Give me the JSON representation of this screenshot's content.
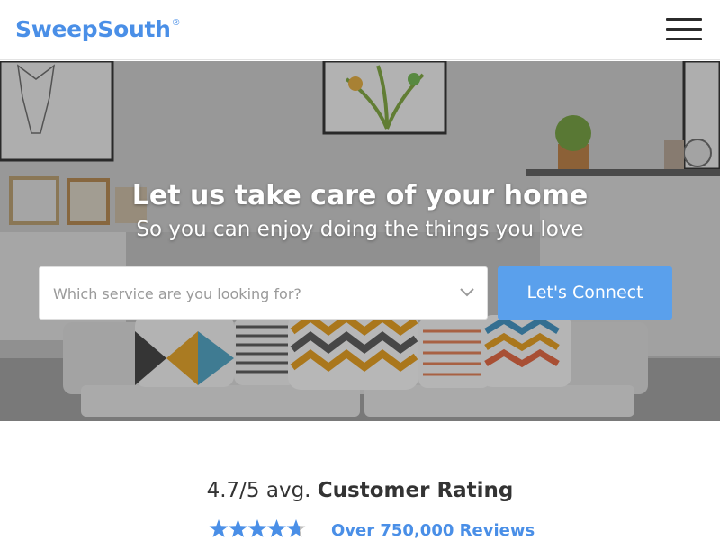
{
  "header": {
    "logo_text": "SweepSouth",
    "logo_mark": "®",
    "menu_icon": "hamburger-menu-icon"
  },
  "hero": {
    "title": "Let us take care of your home",
    "subtitle": "So you can enjoy doing the things you love",
    "service_select": {
      "placeholder": "Which service are you looking for?",
      "icon": "chevron-down-icon"
    },
    "connect_button": "Let's Connect"
  },
  "rating": {
    "score": "4.7/5 avg.",
    "label": "Customer Rating",
    "stars_value": 4.7,
    "stars_max": 5,
    "reviews_link": "Over 750,000 Reviews"
  },
  "colors": {
    "brand_blue": "#4a8fe7",
    "button_blue": "#5aa0ec",
    "star_blue": "#4a8fe7"
  }
}
